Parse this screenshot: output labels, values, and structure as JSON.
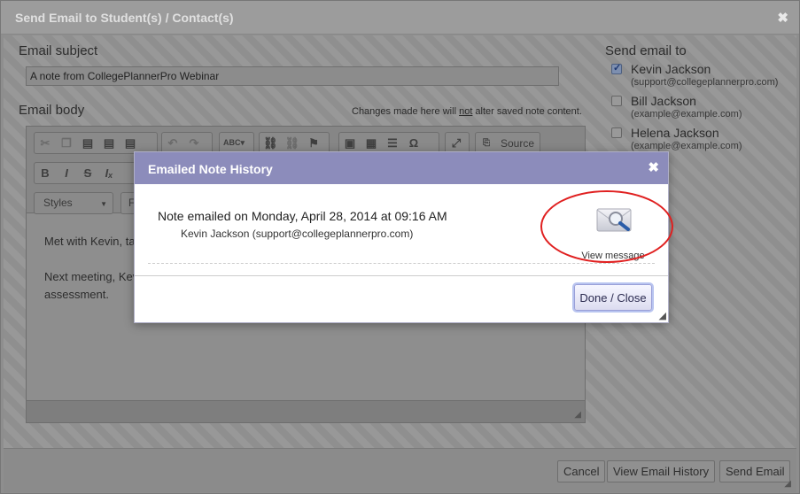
{
  "main_dialog": {
    "title": "Send Email to Student(s) / Contact(s)",
    "close_glyph": "✖"
  },
  "email": {
    "subject_label": "Email subject",
    "subject_value": "A note from CollegePlannerPro Webinar",
    "body_label": "Email body",
    "body_note_before": "Changes made here will ",
    "body_note_emph": "not",
    "body_note_after": " alter saved note content."
  },
  "editor": {
    "source_label": "Source",
    "styles_label": "Styles",
    "format_label": "F",
    "body_line_1": "Met with Kevin, ta",
    "body_line_2": "Next meeting, Kev",
    "body_line_3": "assessment."
  },
  "send_to": {
    "label": "Send email to",
    "recipients": [
      {
        "name": "Kevin Jackson",
        "email": "(support@collegeplannerpro.com)",
        "checked": true
      },
      {
        "name": "Bill Jackson",
        "email": "(example@example.com)",
        "checked": false
      },
      {
        "name": "Helena Jackson",
        "email": "(example@example.com)",
        "checked": false
      }
    ]
  },
  "footer": {
    "cancel": "Cancel",
    "view_history": "View Email History",
    "send": "Send Email"
  },
  "modal": {
    "title": "Emailed Note History",
    "close_glyph": "✖",
    "entry_line1": "Note emailed on Monday, April 28, 2014  at  09:16 AM",
    "entry_line2": "Kevin Jackson (support@collegeplannerpro.com)",
    "view_message": "View message",
    "done": "Done / Close"
  },
  "colors": {
    "modal_header": "#8c8cbb",
    "highlight": "#e02020"
  }
}
